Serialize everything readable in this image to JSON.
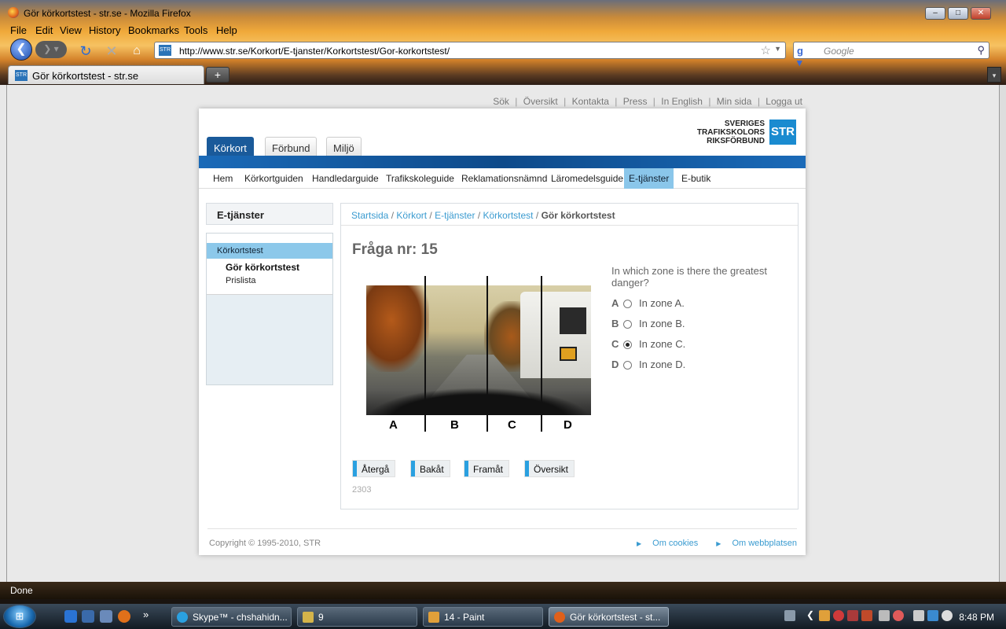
{
  "window": {
    "title": "Gör körkortstest - str.se - Mozilla Firefox",
    "controls": {
      "minimize": "–",
      "maximize": "□",
      "close": "✕"
    }
  },
  "menu": [
    "File",
    "Edit",
    "View",
    "History",
    "Bookmarks",
    "Tools",
    "Help"
  ],
  "nav": {
    "url": "http://www.str.se/Korkort/E-tjanster/Korkortstest/Gor-korkortstest/",
    "search_placeholder": "Google",
    "favicon_text": "STR"
  },
  "tab": {
    "label": "Gör körkortstest - str.se",
    "new_tab": "+"
  },
  "util_links": [
    "Sök",
    "Översikt",
    "Kontakta",
    "Press",
    "In English",
    "Min sida",
    "Logga ut"
  ],
  "logo": {
    "line1": "SVERIGES",
    "line2": "TRAFIKSKOLORS",
    "line3": "RIKSFÖRBUND",
    "badge": "STR"
  },
  "top_tabs": [
    "Körkort",
    "Förbund",
    "Miljö"
  ],
  "subnav": [
    "Hem",
    "Körkortguiden",
    "Handledarguide",
    "Trafikskoleguide",
    "Reklamationsnämnd",
    "Läromedelsguide",
    "E-tjänster",
    "E-butik"
  ],
  "sidebar": {
    "heading": "E-tjänster",
    "section": "Körkortstest",
    "items": [
      "Gör körkortstest",
      "Prislista"
    ]
  },
  "breadcrumb": [
    "Startsida",
    "Körkort",
    "E-tjänster",
    "Körkortstest",
    "Gör körkortstest"
  ],
  "quiz": {
    "title": "Fråga nr: 15",
    "question": "In which zone is there the greatest danger?",
    "zones": [
      "A",
      "B",
      "C",
      "D"
    ],
    "answers": [
      {
        "letter": "A",
        "text": "In zone A.",
        "selected": false
      },
      {
        "letter": "B",
        "text": "In zone B.",
        "selected": false
      },
      {
        "letter": "C",
        "text": "In zone C.",
        "selected": true
      },
      {
        "letter": "D",
        "text": "In zone D.",
        "selected": false
      }
    ],
    "buttons": [
      "Återgå",
      "Bakåt",
      "Framåt",
      "Översikt"
    ],
    "question_id": "2303"
  },
  "footer": {
    "copyright": "Copyright © 1995-2010, STR",
    "links": [
      "Om cookies",
      "Om webbplatsen"
    ]
  },
  "status": "Done",
  "taskbar": {
    "tasks": [
      "Skype™ - chshahidn...",
      "9",
      "14 - Paint",
      "Gör körkortstest - st..."
    ],
    "overflow": "»",
    "clock": "8:48 PM"
  },
  "colors": {
    "accent": "#1a5a9a",
    "link": "#3a9bd0",
    "highlight": "#8cc8ea"
  }
}
